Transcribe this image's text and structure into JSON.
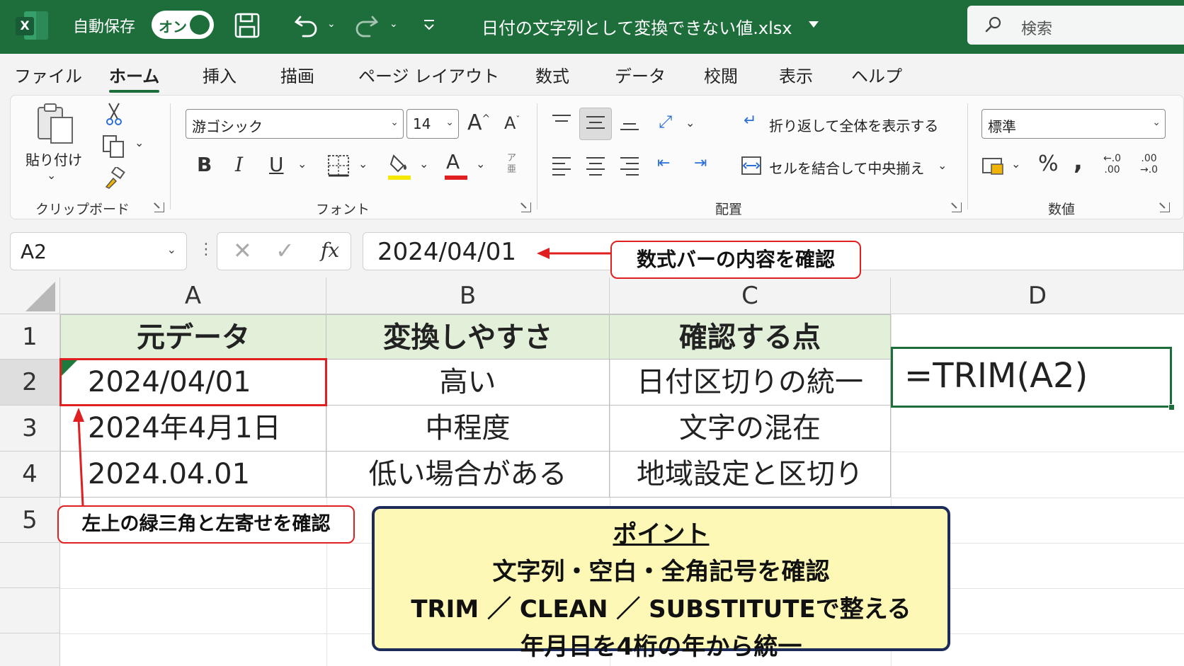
{
  "titlebar": {
    "autosave_label": "自動保存",
    "autosave_state": "オン",
    "filename": "日付の文字列として変換できない値.xlsx",
    "search_placeholder": "検索"
  },
  "menu": {
    "tabs": [
      "ファイル",
      "ホーム",
      "挿入",
      "描画",
      "ページ レイアウト",
      "数式",
      "データ",
      "校閲",
      "表示",
      "ヘルプ"
    ],
    "active": "ホーム"
  },
  "ribbon": {
    "clipboard": {
      "paste_label": "貼り付け",
      "group_label": "クリップボード"
    },
    "font": {
      "font_name": "游ゴシック",
      "font_size": "14",
      "group_label": "フォント",
      "fill_color": "#f5e900",
      "font_color": "#e02020"
    },
    "alignment": {
      "wrap_label": "折り返して全体を表示する",
      "merge_label": "セルを結合して中央揃え",
      "group_label": "配置"
    },
    "number": {
      "format": "標準",
      "group_label": "数値"
    }
  },
  "formula_bar": {
    "name_box": "A2",
    "value": "2024/04/01"
  },
  "sheet": {
    "columns": [
      "A",
      "B",
      "C",
      "D"
    ],
    "rows": [
      "1",
      "2",
      "3",
      "4",
      "5"
    ],
    "header": [
      "元データ",
      "変換しやすさ",
      "確認する点"
    ],
    "data": [
      [
        "2024/04/01",
        "高い",
        "日付区切りの統一"
      ],
      [
        "2024年4月1日",
        "中程度",
        "文字の混在"
      ],
      [
        "2024.04.01",
        "低い場合がある",
        "地域設定と区切り"
      ]
    ],
    "d2_formula": "=TRIM(A2)",
    "header_fill": "#e2efd9"
  },
  "annotations": {
    "formula_callout": "数式バーの内容を確認",
    "cell_callout": "左上の緑三角と左寄せを確認",
    "point": {
      "title": "ポイント",
      "lines": [
        "文字列・空白・全角記号を確認",
        "TRIM ／ CLEAN ／ SUBSTITUTEで整える",
        "年月日を4桁の年から統一"
      ]
    }
  }
}
